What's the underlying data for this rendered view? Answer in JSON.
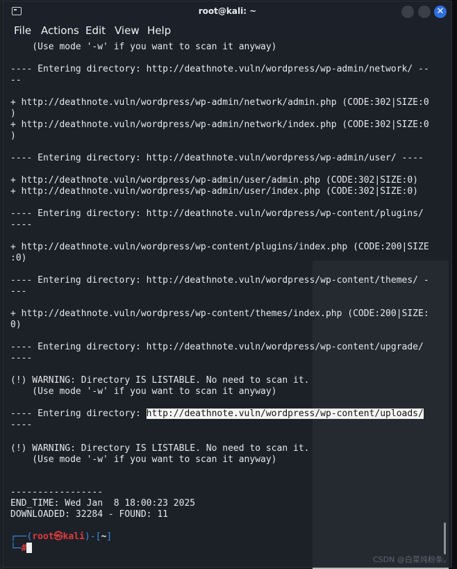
{
  "window": {
    "title": "root@kali: ~"
  },
  "menu": [
    "File",
    "Actions",
    "Edit",
    "View",
    "Help"
  ],
  "terminal_lines": [
    "    (Use mode '-w' if you want to scan it anyway)",
    "",
    "---- Entering directory: http://deathnote.vuln/wordpress/wp-admin/network/ --",
    "--",
    "",
    "+ http://deathnote.vuln/wordpress/wp-admin/network/admin.php (CODE:302|SIZE:0",
    ")",
    "+ http://deathnote.vuln/wordpress/wp-admin/network/index.php (CODE:302|SIZE:0",
    ")",
    "",
    "---- Entering directory: http://deathnote.vuln/wordpress/wp-admin/user/ ----",
    "",
    "+ http://deathnote.vuln/wordpress/wp-admin/user/admin.php (CODE:302|SIZE:0)",
    "+ http://deathnote.vuln/wordpress/wp-admin/user/index.php (CODE:302|SIZE:0)",
    "",
    "---- Entering directory: http://deathnote.vuln/wordpress/wp-content/plugins/",
    "----",
    "",
    "+ http://deathnote.vuln/wordpress/wp-content/plugins/index.php (CODE:200|SIZE",
    ":0)",
    "",
    "---- Entering directory: http://deathnote.vuln/wordpress/wp-content/themes/ -",
    "---",
    "",
    "+ http://deathnote.vuln/wordpress/wp-content/themes/index.php (CODE:200|SIZE:",
    "0)",
    "",
    "---- Entering directory: http://deathnote.vuln/wordpress/wp-content/upgrade/",
    "----",
    "",
    "(!) WARNING: Directory IS LISTABLE. No need to scan it.",
    "    (Use mode '-w' if you want to scan it anyway)",
    "",
    "---- Entering directory: ",
    "----",
    "",
    "",
    "(!) WARNING: Directory IS LISTABLE. No need to scan it.",
    "    (Use mode '-w' if you want to scan it anyway)",
    "",
    "",
    "",
    "-----------------",
    "END_TIME: Wed Jan  8 18:00:23 2025",
    "DOWNLOADED: 32284 - FOUND: 11"
  ],
  "selected_url": "http://deathnote.vuln/wordpress/wp-content/uploads/",
  "prompt": {
    "open": "┌──(",
    "user": "root",
    "at": "㉿",
    "host": "kali",
    "mid": ")-[",
    "dir": "~",
    "close": "]",
    "second_line_prefix": "└─",
    "hash": "#"
  },
  "watermark": "CSDN @白菜炖粉条。",
  "colors": {
    "prompt_red": "#e03b3b",
    "prompt_blue": "#3a8ee6",
    "close_button": "#2f6ee0"
  },
  "icons": [
    "terminal-icon",
    "minimize-icon",
    "maximize-icon",
    "close-icon"
  ]
}
